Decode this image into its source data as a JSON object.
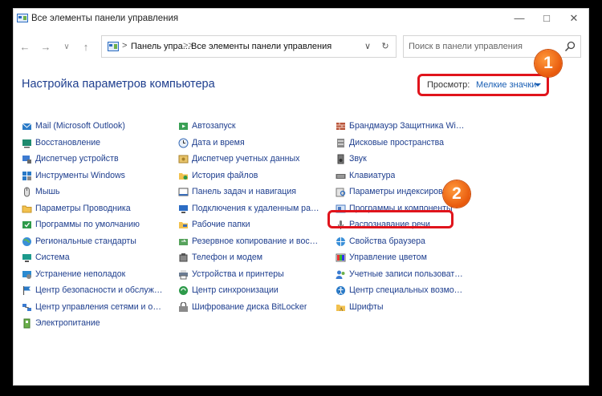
{
  "window": {
    "title": "Все элементы панели управления"
  },
  "address_bar": {
    "crumbs": [
      "Панель упра...",
      "Все элементы панели управления"
    ],
    "separators": [
      ">",
      ">>"
    ]
  },
  "search": {
    "placeholder": "Поиск в панели управления"
  },
  "heading": "Настройка параметров компьютера",
  "view": {
    "label": "Просмотр:",
    "value": "Мелкие значки"
  },
  "callouts": [
    "1",
    "2"
  ],
  "columns": [
    {
      "items": [
        {
          "label": "Mail (Microsoft Outlook)",
          "icon": "mail-icon"
        },
        {
          "label": "Восстановление",
          "icon": "recovery-icon"
        },
        {
          "label": "Диспетчер устройств",
          "icon": "device-manager-icon"
        },
        {
          "label": "Инструменты Windows",
          "icon": "windows-tools-icon"
        },
        {
          "label": "Мышь",
          "icon": "mouse-icon"
        },
        {
          "label": "Параметры Проводника",
          "icon": "explorer-options-icon"
        },
        {
          "label": "Программы по умолчанию",
          "icon": "default-programs-icon"
        },
        {
          "label": "Региональные стандарты",
          "icon": "region-icon"
        },
        {
          "label": "Система",
          "icon": "system-icon"
        },
        {
          "label": "Устранение неполадок",
          "icon": "troubleshooting-icon"
        },
        {
          "label": "Центр безопасности и обслуживания",
          "icon": "security-flag-icon"
        },
        {
          "label": "Центр управления сетями и общим доступом",
          "icon": "network-icon"
        },
        {
          "label": "Электропитание",
          "icon": "power-icon"
        }
      ]
    },
    {
      "items": [
        {
          "label": "Автозапуск",
          "icon": "autoplay-icon"
        },
        {
          "label": "Дата и время",
          "icon": "clock-icon"
        },
        {
          "label": "Диспетчер учетных данных",
          "icon": "credential-icon"
        },
        {
          "label": "История файлов",
          "icon": "file-history-icon"
        },
        {
          "label": "Панель задач и навигация",
          "icon": "taskbar-icon"
        },
        {
          "label": "Подключения к удаленным рабочим столам",
          "icon": "remote-desktop-icon"
        },
        {
          "label": "Рабочие папки",
          "icon": "work-folders-icon"
        },
        {
          "label": "Резервное копирование и восстановление",
          "icon": "backup-icon"
        },
        {
          "label": "Телефон и модем",
          "icon": "phone-icon"
        },
        {
          "label": "Устройства и принтеры",
          "icon": "printer-icon"
        },
        {
          "label": "Центр синхронизации",
          "icon": "sync-icon"
        },
        {
          "label": "Шифрование диска BitLocker",
          "icon": "bitlocker-icon"
        }
      ]
    },
    {
      "items": [
        {
          "label": "Брандмауэр Защитника Windows",
          "icon": "firewall-icon"
        },
        {
          "label": "Дисковые пространства",
          "icon": "storage-spaces-icon"
        },
        {
          "label": "Звук",
          "icon": "sound-icon"
        },
        {
          "label": "Клавиатура",
          "icon": "keyboard-icon"
        },
        {
          "label": "Параметры индексирования",
          "icon": "indexing-icon"
        },
        {
          "label": "Программы и компоненты",
          "icon": "programs-icon"
        },
        {
          "label": "Распознавание речи",
          "icon": "microphone-icon"
        },
        {
          "label": "Свойства браузера",
          "icon": "internet-options-icon"
        },
        {
          "label": "Управление цветом",
          "icon": "color-management-icon"
        },
        {
          "label": "Учетные записи пользователей",
          "icon": "users-icon"
        },
        {
          "label": "Центр специальных возможностей",
          "icon": "accessibility-icon"
        },
        {
          "label": "Шрифты",
          "icon": "fonts-icon"
        }
      ]
    }
  ],
  "colors": {
    "link": "#1e3e8e",
    "highlight": "#e0141c",
    "callout": "#e8590c"
  }
}
